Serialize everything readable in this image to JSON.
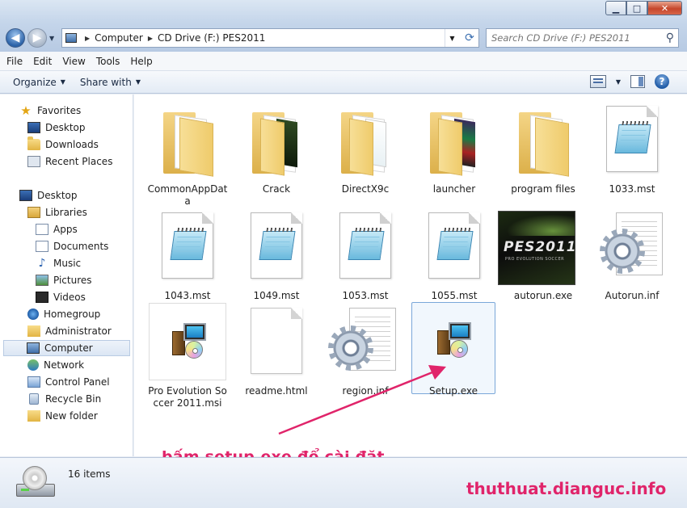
{
  "window": {
    "controls": {
      "minimize": "▁",
      "maximize": "□",
      "close": "✕"
    }
  },
  "address_bar": {
    "crumbs": [
      "Computer",
      "CD Drive (F:) PES2011"
    ],
    "search_placeholder": "Search CD Drive (F:) PES2011"
  },
  "menu": [
    "File",
    "Edit",
    "View",
    "Tools",
    "Help"
  ],
  "toolbar": {
    "organize": "Organize",
    "share_with": "Share with"
  },
  "nav": {
    "favorites": {
      "label": "Favorites",
      "items": [
        "Desktop",
        "Downloads",
        "Recent Places"
      ]
    },
    "desktop": "Desktop",
    "libraries": {
      "label": "Libraries",
      "items": [
        "Apps",
        "Documents",
        "Music",
        "Pictures",
        "Videos"
      ]
    },
    "homegroup": "Homegroup",
    "administrator": "Administrator",
    "computer": "Computer",
    "network": "Network",
    "control_panel": "Control Panel",
    "recycle_bin": "Recycle Bin",
    "new_folder": "New folder"
  },
  "files": [
    {
      "name": "CommonAppData",
      "type": "folder"
    },
    {
      "name": "Crack",
      "type": "folder"
    },
    {
      "name": "DirectX9c",
      "type": "folder"
    },
    {
      "name": "launcher",
      "type": "folder"
    },
    {
      "name": "program files",
      "type": "folder"
    },
    {
      "name": "1033.mst",
      "type": "mst"
    },
    {
      "name": "1043.mst",
      "type": "mst"
    },
    {
      "name": "1049.mst",
      "type": "mst"
    },
    {
      "name": "1053.mst",
      "type": "mst"
    },
    {
      "name": "1055.mst",
      "type": "mst"
    },
    {
      "name": "autorun.exe",
      "type": "pes-exe"
    },
    {
      "name": "Autorun.inf",
      "type": "inf"
    },
    {
      "name": "Pro Evolution Soccer 2011.msi",
      "type": "installer"
    },
    {
      "name": "readme.html",
      "type": "html"
    },
    {
      "name": "region.inf",
      "type": "inf"
    },
    {
      "name": "Setup.exe",
      "type": "installer",
      "selected": true
    }
  ],
  "pes_logo": {
    "title": "PES2011",
    "subtitle": "PRO EVOLUTION SOCCER"
  },
  "status": {
    "item_count": "16 items"
  },
  "annotation": {
    "text": "bấm setup.exe để cài đặt",
    "color": "#e0246a"
  },
  "watermark": "thuthuat.dianguc.info",
  "colors": {
    "accent": "#e0246a",
    "selection": "#7aa7d9"
  }
}
